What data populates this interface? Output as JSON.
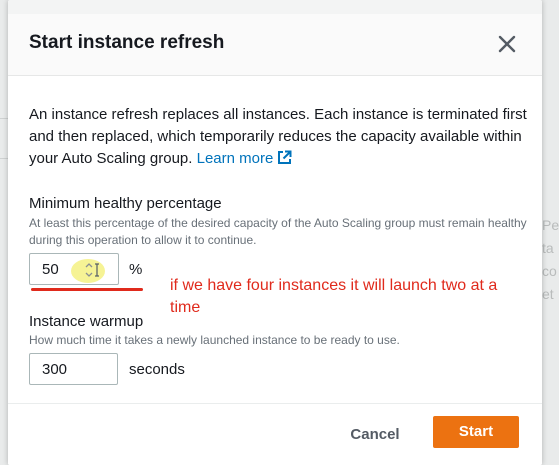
{
  "dialog": {
    "title": "Start instance refresh",
    "close_icon": "close-icon",
    "intro_text": "An instance refresh replaces all instances. Each instance is terminated first and then replaced, which temporarily reduces the capacity available within your Auto Scaling group.",
    "learn_more_label": "Learn more",
    "learn_more_icon": "external-link-icon"
  },
  "min_healthy": {
    "label": "Minimum healthy percentage",
    "description": "At least this percentage of the desired capacity of the Auto Scaling group must remain healthy during this operation to allow it to continue.",
    "value": "50",
    "unit": "%"
  },
  "warmup": {
    "label": "Instance warmup",
    "description": "How much time it takes a newly launched instance to be ready to use.",
    "value": "300",
    "unit": "seconds"
  },
  "annotation": {
    "text": "if we have four instances it will launch two at a time",
    "color": "#e02a1c"
  },
  "footer": {
    "cancel_label": "Cancel",
    "start_label": "Start"
  },
  "colors": {
    "primary_button": "#ec7211",
    "link": "#0073bb",
    "highlight": "#f5f28a"
  },
  "background_fragments": [
    "Pe",
    "ta",
    "co",
    "et"
  ]
}
